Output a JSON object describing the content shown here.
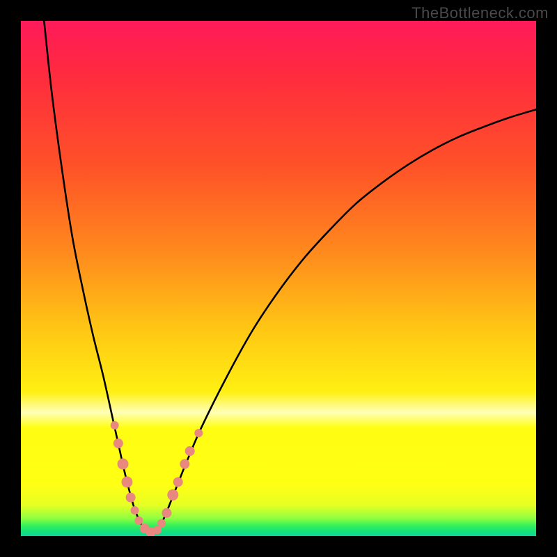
{
  "watermark": "TheBottleneck.com",
  "chart_data": {
    "type": "line",
    "title": "",
    "xlabel": "",
    "ylabel": "",
    "xlim": [
      0,
      100
    ],
    "ylim": [
      0,
      100
    ],
    "grid": false,
    "legend": false,
    "series": [
      {
        "name": "left-branch",
        "x": [
          4.5,
          6,
          8,
          10,
          12,
          14,
          16,
          18,
          19,
          20,
          21,
          22,
          23,
          24,
          25
        ],
        "y": [
          100,
          86,
          71,
          58,
          48,
          39,
          31,
          22,
          17.5,
          13,
          9,
          5.5,
          3,
          1.3,
          0.6
        ]
      },
      {
        "name": "right-branch",
        "x": [
          25,
          26,
          27,
          28,
          30,
          32,
          35,
          40,
          45,
          50,
          55,
          60,
          65,
          70,
          75,
          80,
          85,
          90,
          95,
          100
        ],
        "y": [
          0.6,
          1.0,
          2.0,
          4.0,
          9.0,
          14.0,
          21.0,
          31.0,
          40.0,
          47.5,
          54.0,
          59.5,
          64.5,
          68.5,
          72.0,
          75.0,
          77.5,
          79.5,
          81.3,
          82.8
        ]
      }
    ],
    "markers": {
      "name": "highlight-dots",
      "color": "#e8887f",
      "points": [
        {
          "x": 18.2,
          "y": 21.5,
          "r": 6
        },
        {
          "x": 18.9,
          "y": 18.0,
          "r": 7
        },
        {
          "x": 19.8,
          "y": 14.0,
          "r": 8
        },
        {
          "x": 20.6,
          "y": 10.5,
          "r": 8
        },
        {
          "x": 21.3,
          "y": 7.5,
          "r": 7
        },
        {
          "x": 22.1,
          "y": 5.0,
          "r": 6
        },
        {
          "x": 22.9,
          "y": 3.0,
          "r": 6
        },
        {
          "x": 24.0,
          "y": 1.5,
          "r": 7
        },
        {
          "x": 25.2,
          "y": 0.8,
          "r": 7
        },
        {
          "x": 26.5,
          "y": 1.2,
          "r": 6
        },
        {
          "x": 27.3,
          "y": 2.5,
          "r": 6
        },
        {
          "x": 28.3,
          "y": 4.5,
          "r": 7
        },
        {
          "x": 29.5,
          "y": 8.0,
          "r": 8
        },
        {
          "x": 30.5,
          "y": 10.5,
          "r": 7
        },
        {
          "x": 31.8,
          "y": 14.0,
          "r": 7
        },
        {
          "x": 32.8,
          "y": 16.5,
          "r": 7
        },
        {
          "x": 34.5,
          "y": 20.0,
          "r": 6
        }
      ]
    },
    "background_gradient": {
      "stops": [
        {
          "pos": 0,
          "color": "#ff1a5a"
        },
        {
          "pos": 10,
          "color": "#ff2a3f"
        },
        {
          "pos": 28,
          "color": "#ff5128"
        },
        {
          "pos": 45,
          "color": "#ff8a1d"
        },
        {
          "pos": 60,
          "color": "#ffc714"
        },
        {
          "pos": 72,
          "color": "#fff012"
        },
        {
          "pos": 76,
          "color": "#ffffb8"
        },
        {
          "pos": 79,
          "color": "#fffe12"
        },
        {
          "pos": 90,
          "color": "#ffff14"
        },
        {
          "pos": 94,
          "color": "#e6ff24"
        },
        {
          "pos": 96.5,
          "color": "#92ff40"
        },
        {
          "pos": 98,
          "color": "#33f05a"
        },
        {
          "pos": 99,
          "color": "#16e27a"
        },
        {
          "pos": 100,
          "color": "#0fd696"
        }
      ]
    }
  }
}
